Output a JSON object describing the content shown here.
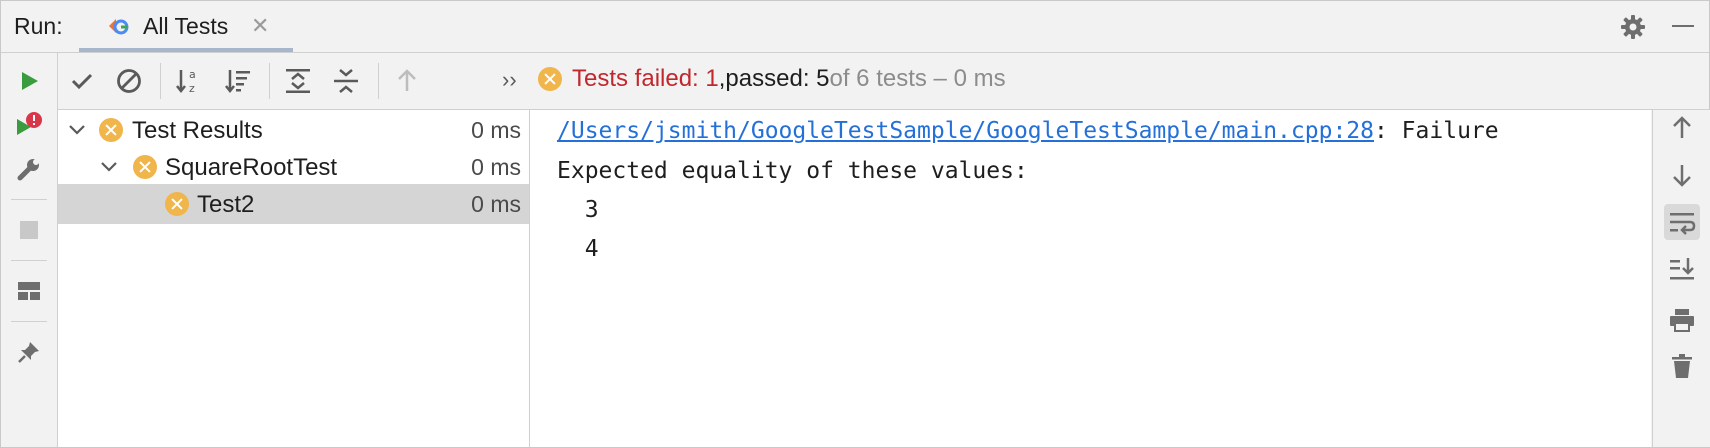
{
  "window": {
    "run_label": "Run:",
    "tab_label": "All Tests",
    "tab_close": "✕"
  },
  "toolbar": {
    "more": "››",
    "status": {
      "failed_text": "Tests failed: 1",
      "comma": ", ",
      "passed_text": "passed: 5",
      "rest_text": " of 6 tests – 0 ms"
    }
  },
  "tree": {
    "rows": [
      {
        "label": "Test Results",
        "time": "0 ms"
      },
      {
        "label": "SquareRootTest",
        "time": "0 ms"
      },
      {
        "label": "Test2",
        "time": "0 ms",
        "selected": true
      }
    ]
  },
  "console": {
    "link": "/Users/jsmith/GoogleTestSample/GoogleTestSample/main.cpp:28",
    "link_suffix": ": Failure",
    "lines": [
      "Expected equality of these values:",
      "  3",
      "  4"
    ]
  },
  "colors": {
    "failed": "#c1272d",
    "fail_icon": "#f0b54b",
    "run_green": "#3a9c3e",
    "link": "#2470d8",
    "selection": "#d5d5d5"
  },
  "icons": {
    "left_strip": [
      "run-icon",
      "rerun-failed-icon",
      "settings-wrench-icon",
      "stop-icon",
      "layout-icon",
      "pin-icon"
    ],
    "toolbar": [
      "show-passed-icon",
      "show-ignored-icon",
      "sort-alphabetically-icon",
      "sort-by-duration-icon",
      "expand-all-icon",
      "collapse-all-icon",
      "previous-failed-icon"
    ],
    "right_strip": [
      "up-arrow-icon",
      "down-arrow-icon",
      "soft-wrap-icon",
      "scroll-to-end-icon",
      "print-icon",
      "trash-icon"
    ]
  }
}
